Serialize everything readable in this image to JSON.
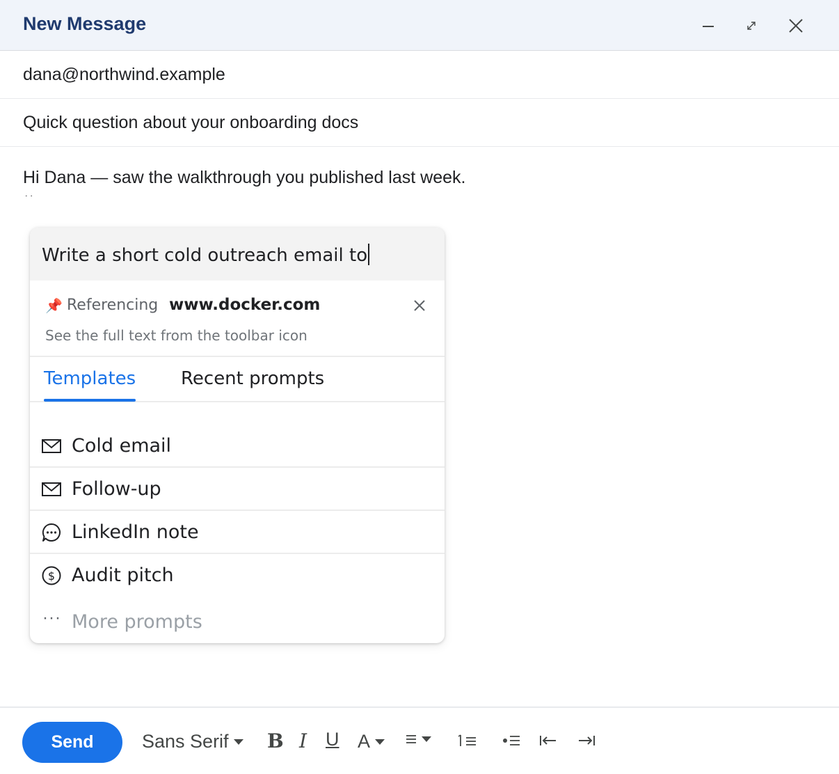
{
  "window": {
    "title": "New Message",
    "minimize_icon": "minimize-icon",
    "expand_icon": "expand-icon",
    "close_icon": "close-icon"
  },
  "to": {
    "value": "dana@northwind.example"
  },
  "subject": {
    "value": "Quick question about your onboarding docs"
  },
  "body": {
    "line1": "Hi Dana — saw the walkthrough you published last week.",
    "line2": "``"
  },
  "ai_popup": {
    "prompt_text": "Write a short cold outreach email to",
    "reference": {
      "pin_icon": "📌",
      "label": "Referencing",
      "domain": "www.docker.com",
      "hint": "See the full text from the toolbar icon"
    },
    "tabs": [
      {
        "label": "Templates",
        "active": true
      },
      {
        "label": "Recent prompts",
        "active": false
      }
    ],
    "templates": [
      {
        "label": "Cold email",
        "icon": "mail-icon"
      },
      {
        "label": "Follow-up",
        "icon": "mail-icon"
      },
      {
        "label": "LinkedIn note",
        "icon": "chat-bubble-icon"
      },
      {
        "label": "Audit pitch",
        "icon": "dollar-circle-icon"
      }
    ],
    "more": {
      "dots": "···",
      "label": "More prompts"
    }
  },
  "toolbar": {
    "send_label": "Send",
    "font": "Sans Serif",
    "bold": "B",
    "italic": "I",
    "underline": "U",
    "text_color": "A"
  },
  "colors": {
    "accent": "#1a73e8",
    "header_bg": "#f0f4fa",
    "title": "#1f3a6e"
  }
}
